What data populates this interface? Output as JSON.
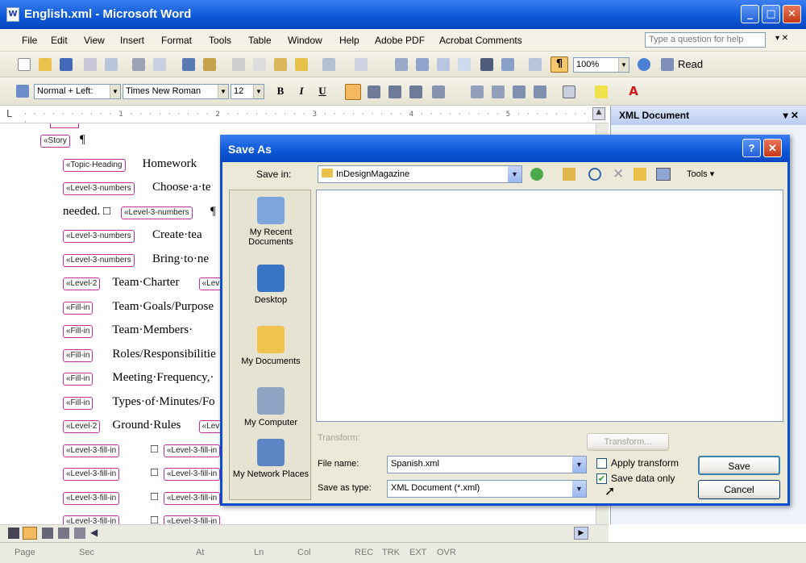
{
  "window": {
    "title": "English.xml - Microsoft Word"
  },
  "menu": [
    "File",
    "Edit",
    "View",
    "Insert",
    "Format",
    "Tools",
    "Table",
    "Window",
    "Help",
    "Adobe PDF",
    "Acrobat Comments"
  ],
  "ask_placeholder": "Type a question for help",
  "standard_toolbar": {
    "zoom": "100%",
    "read_label": "Read"
  },
  "formatting_toolbar": {
    "style": "Normal + Left:",
    "font": "Times New Roman",
    "size": "12"
  },
  "task_pane": {
    "title": "XML Document"
  },
  "document": {
    "lines": [
      {
        "tags": [
          "Story"
        ],
        "text": "¶"
      },
      {
        "tags": [
          "Topic-Heading"
        ],
        "text": "Homework"
      },
      {
        "tags": [
          "Level-3-numbers"
        ],
        "text": "Choose·a·te"
      },
      {
        "tags": [
          "Level-3-numbers"
        ],
        "pre": "needed.",
        "text": "¶"
      },
      {
        "tags": [
          "Level-3-numbers"
        ],
        "text": "Create·tea"
      },
      {
        "tags": [
          "Level-3-numbers"
        ],
        "text": "Bring·to·ne"
      },
      {
        "tags": [
          "Level-2"
        ],
        "text": "Team·Charter",
        "extra": "Lev"
      },
      {
        "tags": [
          "Fill-in"
        ],
        "text": "Team·Goals/Purpose"
      },
      {
        "tags": [
          "Fill-in"
        ],
        "text": "Team·Members·"
      },
      {
        "tags": [
          "Fill-in"
        ],
        "text": "Roles/Responsibilitie"
      },
      {
        "tags": [
          "Fill-in"
        ],
        "text": "Meeting·Frequency,·"
      },
      {
        "tags": [
          "Fill-in"
        ],
        "text": "Types·of·Minutes/Fo"
      },
      {
        "tags": [
          "Level-2"
        ],
        "text": "Ground·Rules",
        "extra": "Lev"
      },
      {
        "tags": [
          "Level-3-fill-in",
          "Level-3-fill-in"
        ],
        "text": ""
      },
      {
        "tags": [
          "Level-3-fill-in",
          "Level-3-fill-in"
        ],
        "text": ""
      },
      {
        "tags": [
          "Level-3-fill-in",
          "Level-3-fill-in"
        ],
        "text": ""
      },
      {
        "tags": [
          "Level-3-fill-in",
          "Level-3-fill-in"
        ],
        "text": ""
      }
    ]
  },
  "status": {
    "page": "Page",
    "sec": "Sec",
    "at": "At",
    "ln": "Ln",
    "col": "Col",
    "rec": "REC",
    "trk": "TRK",
    "ext": "EXT",
    "ovr": "OVR"
  },
  "dialog": {
    "title": "Save As",
    "save_in_label": "Save in:",
    "save_in_value": "InDesignMagazine",
    "tools_label": "Tools",
    "places": [
      "My Recent Documents",
      "Desktop",
      "My Documents",
      "My Computer",
      "My Network Places"
    ],
    "transform_label": "Transform:",
    "transform_button": "Transform...",
    "file_name_label": "File name:",
    "file_name_value": "Spanish.xml",
    "save_type_label": "Save as type:",
    "save_type_value": "XML Document (*.xml)",
    "apply_transform": "Apply transform",
    "apply_transform_checked": false,
    "save_data_only": "Save data only",
    "save_data_only_checked": true,
    "save_button": "Save",
    "cancel_button": "Cancel"
  }
}
